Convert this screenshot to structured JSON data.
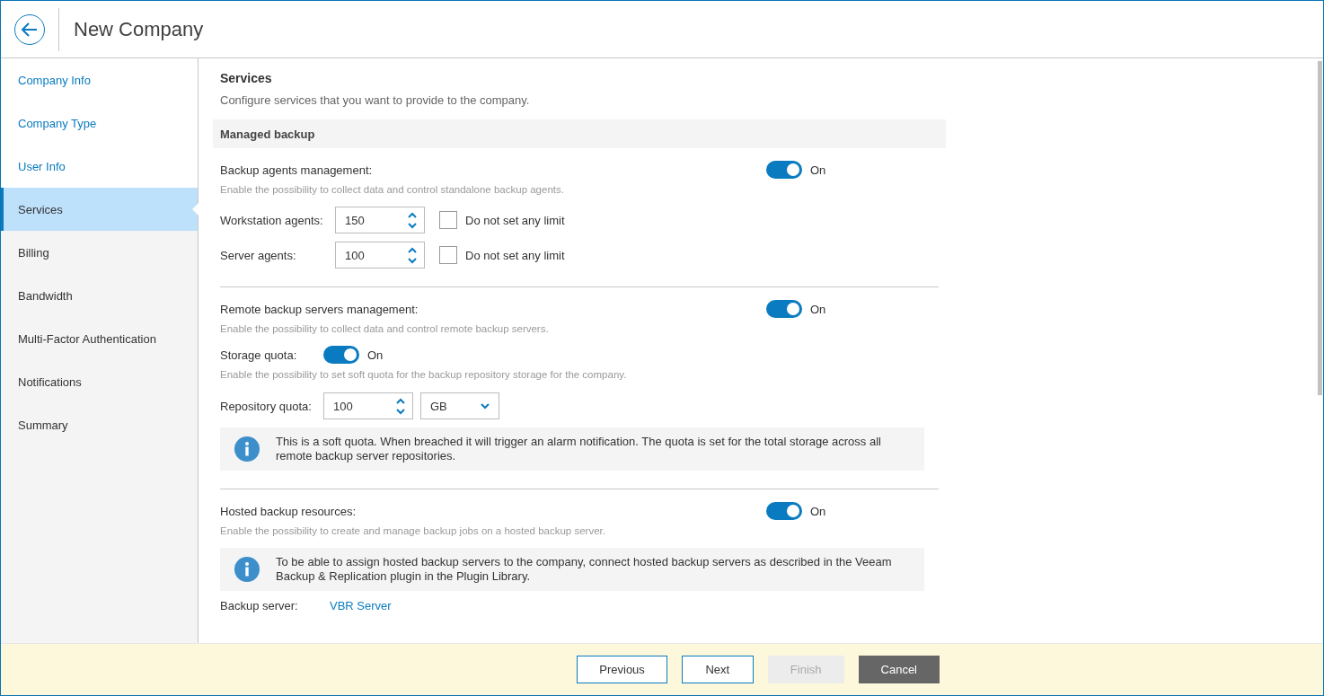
{
  "header": {
    "title": "New Company"
  },
  "sidebar": {
    "items": [
      {
        "label": "Company Info",
        "selected": false,
        "completed": true
      },
      {
        "label": "Company Type",
        "selected": false,
        "completed": true
      },
      {
        "label": "User Info",
        "selected": false,
        "completed": true
      },
      {
        "label": "Services",
        "selected": true,
        "completed": false
      },
      {
        "label": "Billing",
        "selected": false,
        "completed": false
      },
      {
        "label": "Bandwidth",
        "selected": false,
        "completed": false
      },
      {
        "label": "Multi-Factor Authentication",
        "selected": false,
        "completed": false
      },
      {
        "label": "Notifications",
        "selected": false,
        "completed": false
      },
      {
        "label": "Summary",
        "selected": false,
        "completed": false
      }
    ]
  },
  "page": {
    "title": "Services",
    "description": "Configure services that you want to provide to the company.",
    "section_heading": "Managed backup",
    "blocks": [
      {
        "kind": "toggle",
        "label": "Backup agents management:",
        "on": true,
        "state_label": "On"
      },
      {
        "kind": "hint",
        "text": "Enable the possibility to collect data and control standalone backup agents."
      },
      {
        "kind": "spinner",
        "label": "Workstation agents:",
        "value": "150",
        "checkbox_label": "Do not set any limit",
        "checked": false
      },
      {
        "kind": "spinner",
        "label": "Server agents:",
        "value": "100",
        "checkbox_label": "Do not set any limit",
        "checked": false
      },
      {
        "kind": "divider"
      },
      {
        "kind": "toggle",
        "label": "Remote backup servers management:",
        "on": true,
        "state_label": "On"
      },
      {
        "kind": "hint",
        "text": "Enable the possibility to collect data and control remote backup servers."
      },
      {
        "kind": "inline-toggle",
        "label": "Storage quota:",
        "on": true,
        "state_label": "On"
      },
      {
        "kind": "hint",
        "text": "Enable the possibility to set soft quota for the backup repository storage for the company."
      },
      {
        "kind": "quota",
        "label": "Repository quota:",
        "value": "100",
        "unit": "GB"
      },
      {
        "kind": "info",
        "text": "This is a soft quota. When breached it will trigger an alarm notification. The quota is set for the total storage across all remote backup server repositories."
      },
      {
        "kind": "divider"
      },
      {
        "kind": "toggle",
        "label": "Hosted backup resources:",
        "on": true,
        "state_label": "On"
      },
      {
        "kind": "hint",
        "text": "Enable the possibility to create and manage backup jobs on a hosted backup server."
      },
      {
        "kind": "info",
        "text": "To be able to assign hosted backup servers to the company, connect hosted backup servers as described in the Veeam Backup & Replication plugin in the Plugin Library."
      },
      {
        "kind": "link",
        "label": "Backup server:",
        "value": "VBR Server"
      }
    ]
  },
  "footer": {
    "buttons": [
      {
        "label": "Previous",
        "kind": "outline",
        "disabled": false
      },
      {
        "label": "Next",
        "kind": "outline",
        "disabled": false
      },
      {
        "label": "Finish",
        "kind": "outline",
        "disabled": true
      },
      {
        "label": "Cancel",
        "kind": "dark",
        "disabled": false
      }
    ]
  }
}
